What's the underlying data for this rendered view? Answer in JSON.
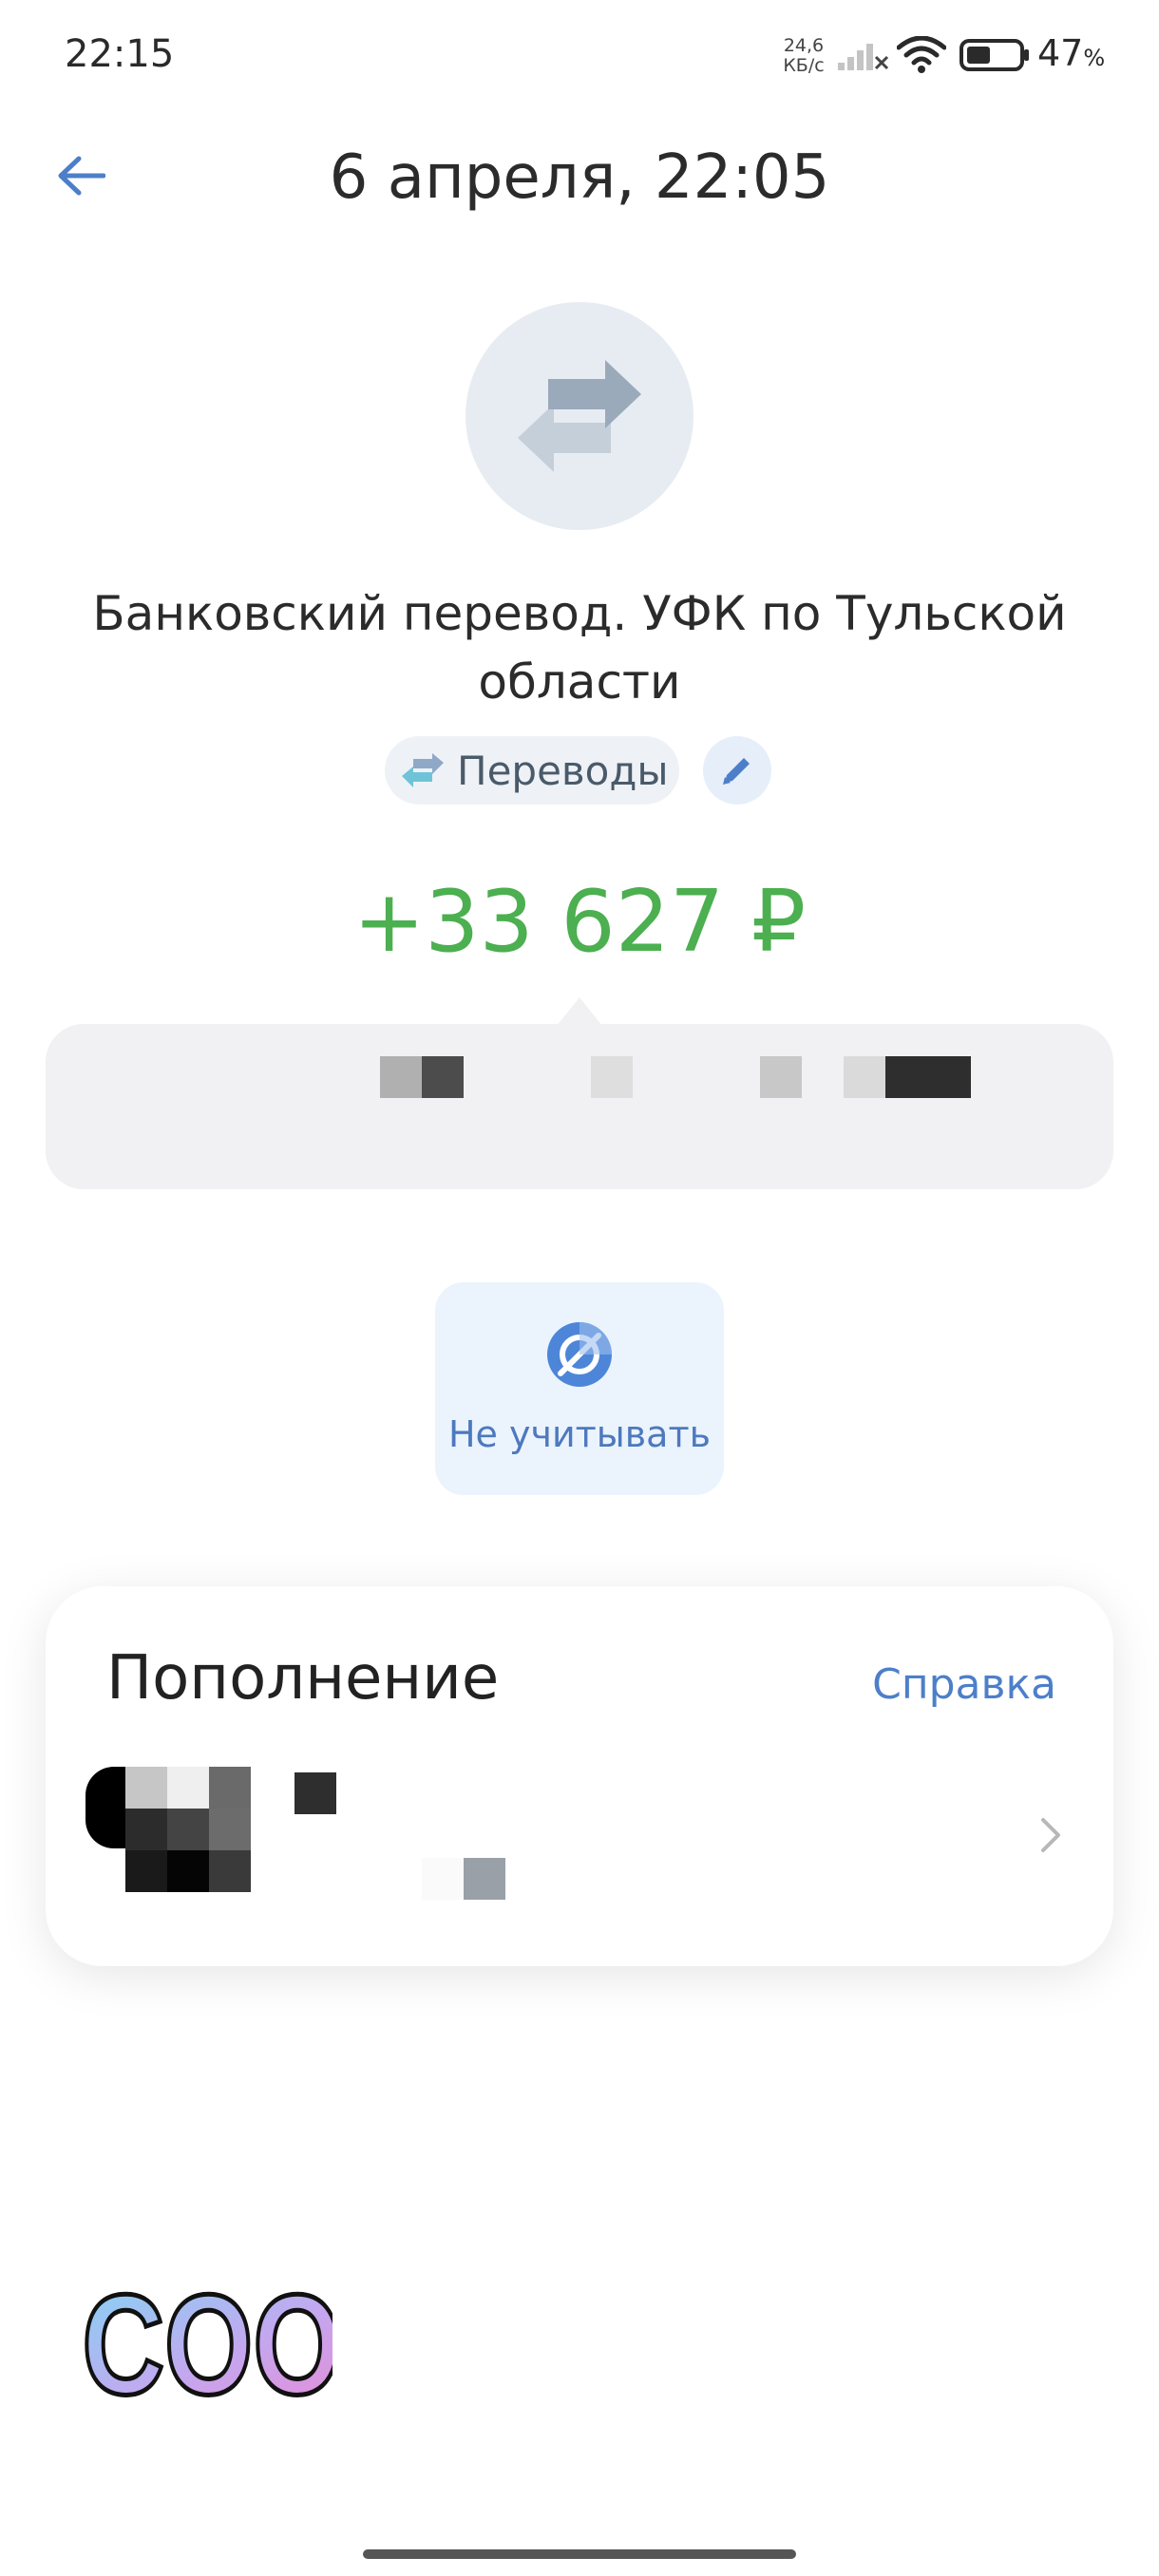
{
  "status_bar": {
    "time": "22:15",
    "net_speed_value": "24,6",
    "net_speed_unit": "КБ/с",
    "battery_percent": "47",
    "battery_unit": "%",
    "battery_level": 0.47
  },
  "header": {
    "title": "6 апреля, 22:05",
    "back_icon": "arrow-left-icon"
  },
  "transaction": {
    "icon": "transfer-arrows-icon",
    "title": "Банковский перевод. УФК по Тульской области",
    "category": "Переводы",
    "category_icon": "transfer-arrows-icon",
    "edit_icon": "pencil-icon",
    "amount": "+33 627 ₽",
    "amount_color": "#4caf50"
  },
  "actions": {
    "ignore_label": "Не учитывать",
    "ignore_icon": "eye-off-icon"
  },
  "card": {
    "title": "Пополнение",
    "help_label": "Справка",
    "chevron_icon": "chevron-right-icon"
  },
  "sticker": {
    "text": "COOL"
  },
  "colors": {
    "accent": "#4d7fc9",
    "positive": "#4caf50"
  }
}
